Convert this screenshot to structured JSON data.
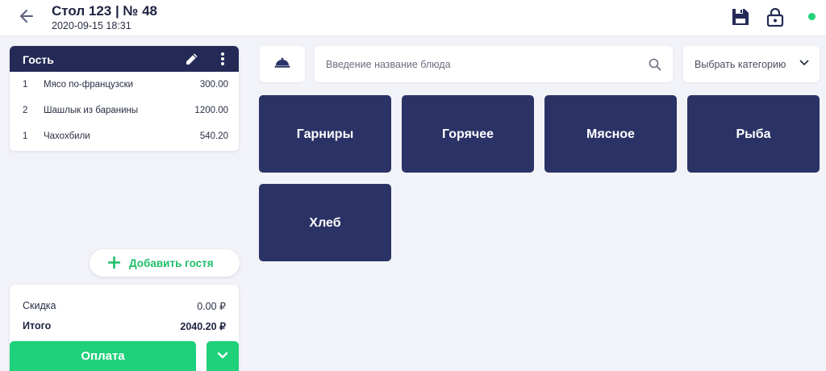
{
  "header": {
    "title": "Стол 123 | № 48",
    "datetime": "2020-09-15 18:31",
    "icons": [
      "arrow-left-icon",
      "save-icon",
      "lock-icon"
    ],
    "status_color": "#1fd17a"
  },
  "guest": {
    "title": "Гость",
    "items": [
      {
        "qty": "1",
        "name": "Мясо по-французски",
        "price": "300.00"
      },
      {
        "qty": "2",
        "name": "Шашлык из баранины",
        "price": "1200.00"
      },
      {
        "qty": "1",
        "name": "Чахохбили",
        "price": "540.20"
      }
    ]
  },
  "add_guest_label": "Добавить гостя",
  "totals": {
    "discount_label": "Скидка",
    "discount_value": "0.00 ₽",
    "total_label": "Итого",
    "total_value": "2040.20 ₽"
  },
  "pay_label": "Оплата",
  "search": {
    "placeholder": "Введение название блюда"
  },
  "category_select": {
    "label": "Выбрать категорию"
  },
  "categories": [
    "Гарниры",
    "Горячее",
    "Мясное",
    "Рыба",
    "Хлеб"
  ],
  "colors": {
    "accent": "#1fd17a",
    "navy": "#2b3366",
    "header_navy": "#242a55",
    "background": "#f2f3f8"
  }
}
